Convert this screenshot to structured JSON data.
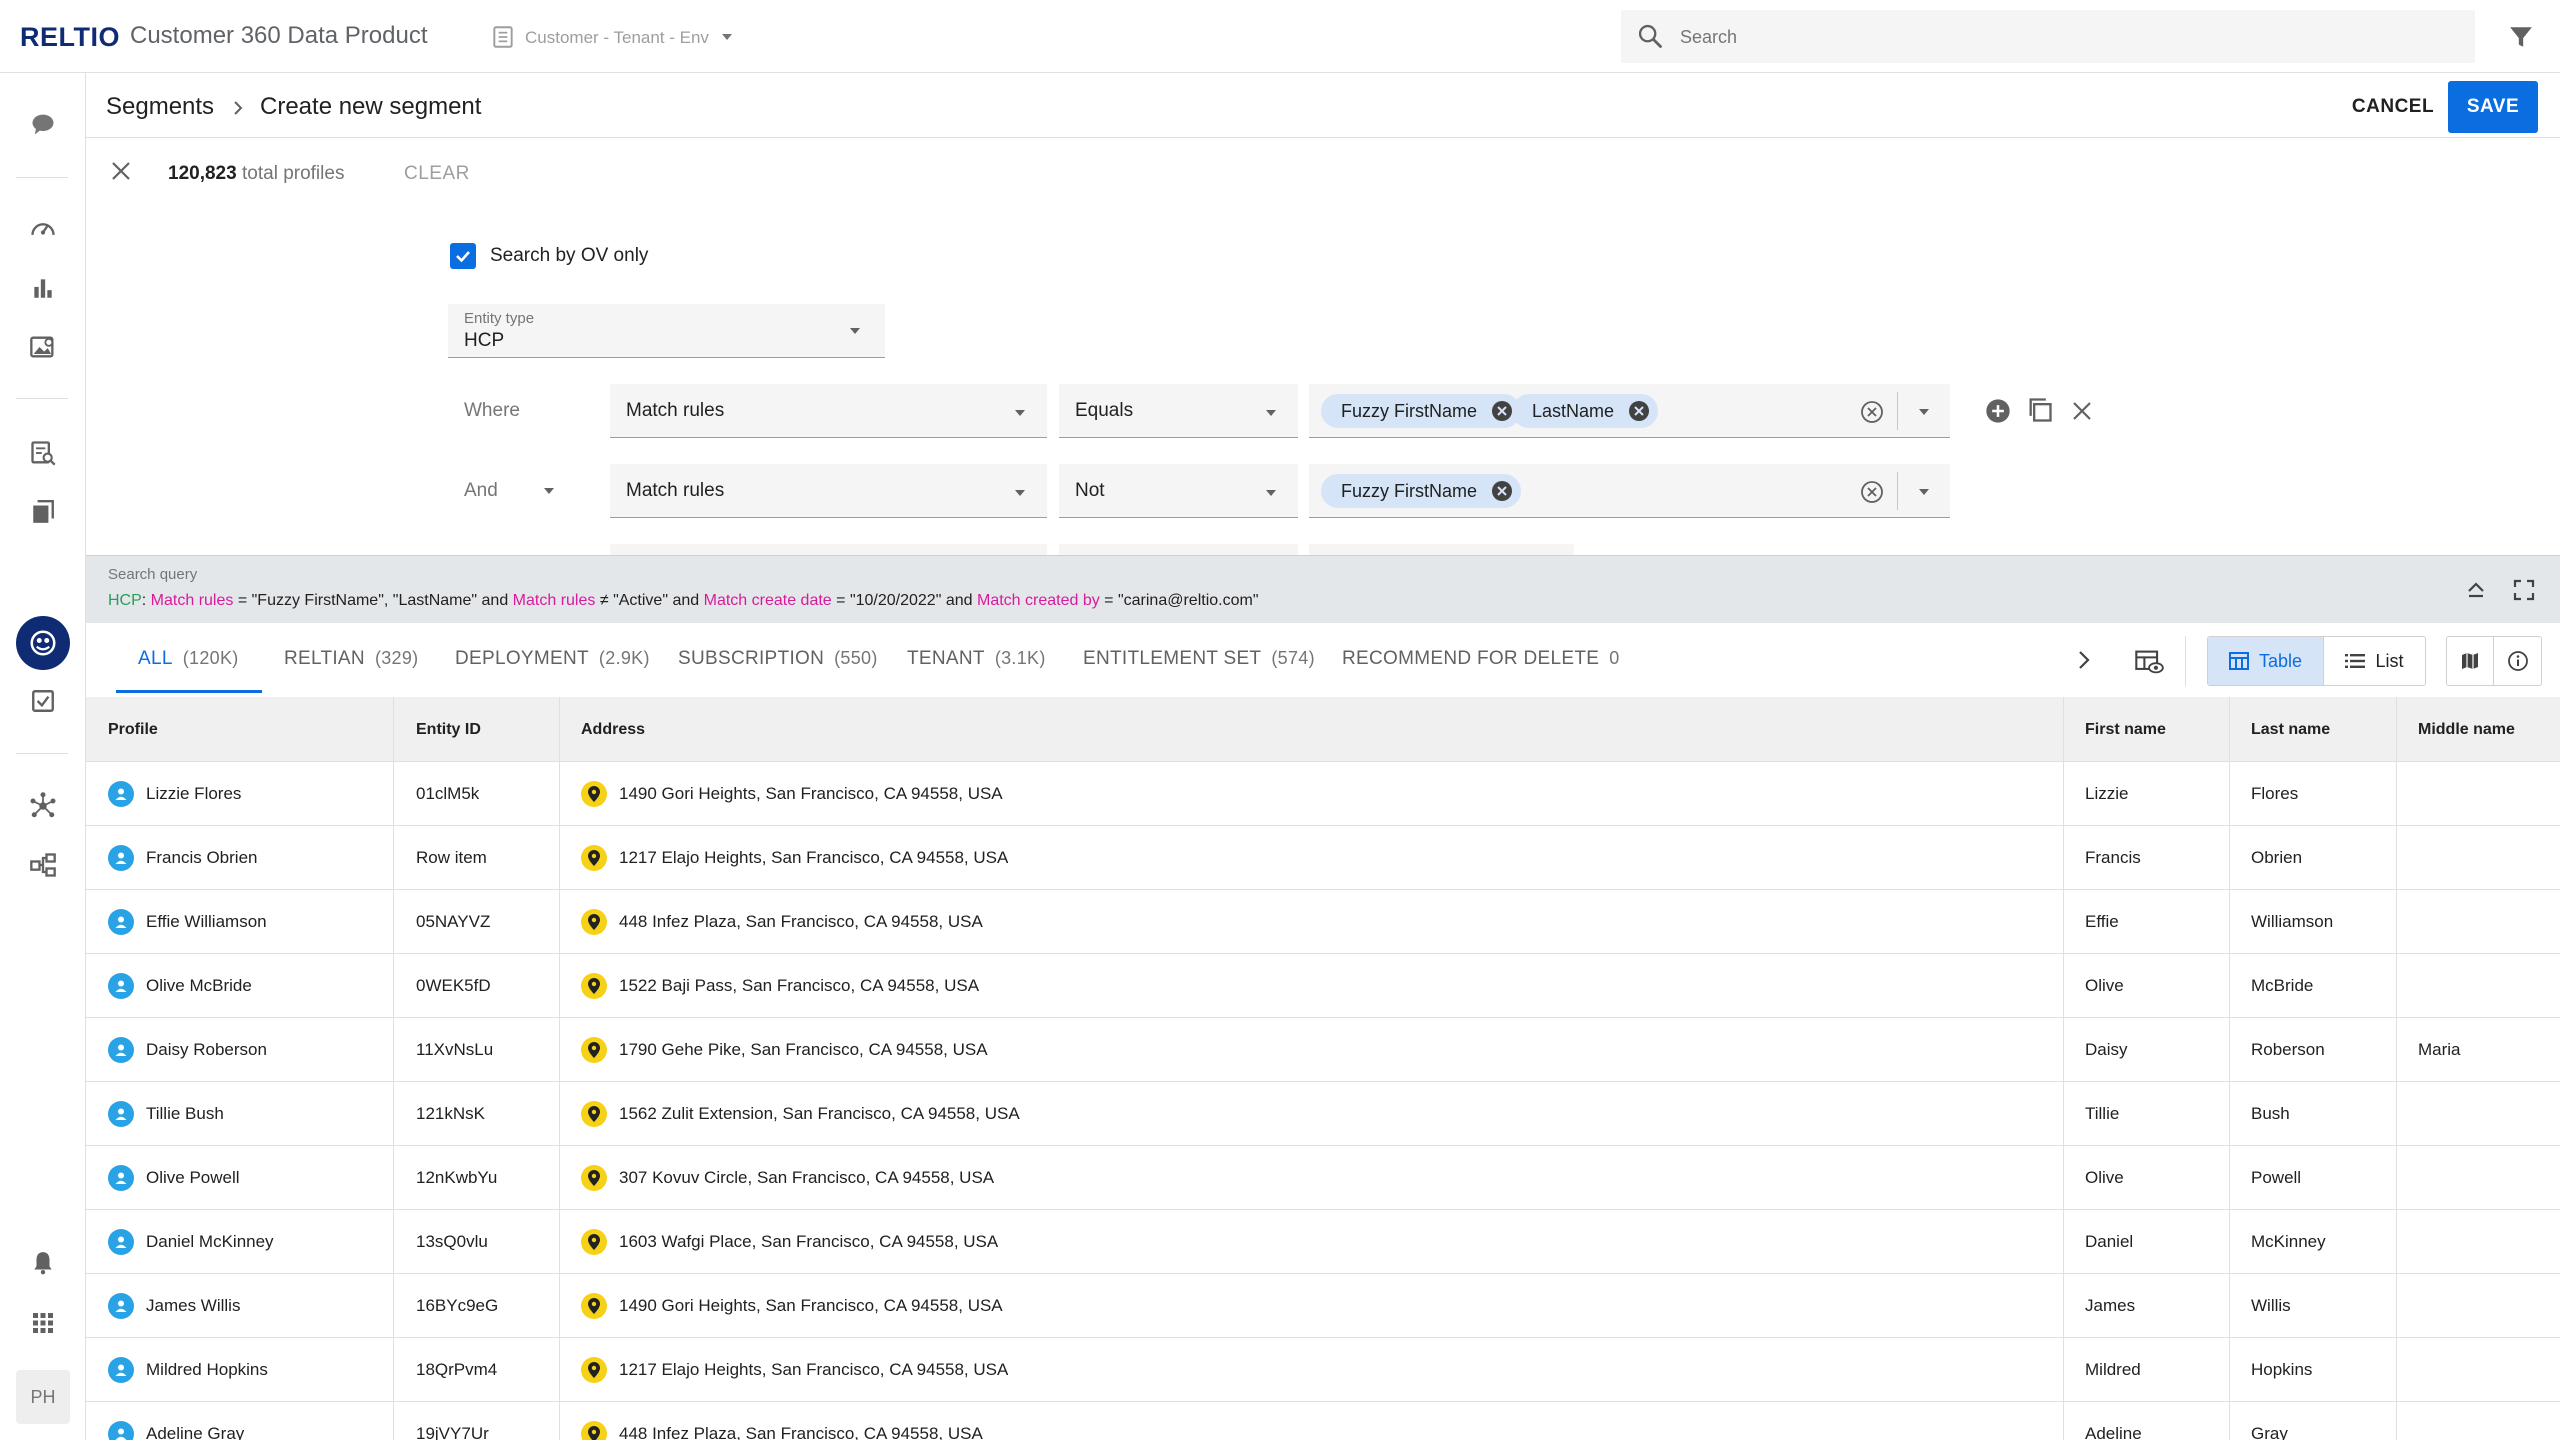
{
  "topbar": {
    "logo": "RELTIO",
    "app_title": "Customer 360 Data Product",
    "context": "Customer - Tenant - Env",
    "search_placeholder": "Search"
  },
  "leftnav": {
    "icons": [
      "chat-icon",
      "dashboard-icon",
      "bar-chart-icon",
      "image-search-icon",
      "search-list-icon",
      "library-icon",
      "segments-icon",
      "task-check-icon",
      "graph-icon",
      "hierarchy-icon",
      "bell-icon",
      "apps-grid-icon"
    ],
    "avatar_initials": "PH"
  },
  "header": {
    "breadcrumb_root": "Segments",
    "breadcrumb_current": "Create new segment",
    "cancel_label": "CANCEL",
    "save_label": "SAVE"
  },
  "summary": {
    "total_count": "120,823",
    "total_label": "total profiles",
    "clear_label": "CLEAR"
  },
  "builder": {
    "ov_only_label": "Search by OV only",
    "ov_only_checked": true,
    "entity_type_caption": "Entity type",
    "entity_type_value": "HCP",
    "conditions": [
      {
        "connector": "Where",
        "attribute": "Match rules",
        "operator": "Equals",
        "values": [
          "Fuzzy FirstName",
          "LastName"
        ]
      },
      {
        "connector": "And",
        "attribute": "Match rules",
        "operator": "Not",
        "values": [
          "Fuzzy FirstName"
        ]
      }
    ]
  },
  "search_query": {
    "title": "Search query",
    "entity": "HCP",
    "parts": [
      {
        "attr": "Match rules",
        "op": "=",
        "val": "\"Fuzzy FirstName\", \"LastName\""
      },
      {
        "conj": "and",
        "attr": "Match rules",
        "op": "≠",
        "val": "\"Active\""
      },
      {
        "conj": "and",
        "attr": "Match create date",
        "op": "=",
        "val": "\"10/20/2022\""
      },
      {
        "conj": "and",
        "attr": "Match created by",
        "op": "=",
        "val": "\"carina@reltio.com\""
      }
    ]
  },
  "tabs": [
    {
      "label": "ALL",
      "count": "(120K)",
      "active": true
    },
    {
      "label": "RELTIAN",
      "count": "(329)"
    },
    {
      "label": "DEPLOYMENT",
      "count": "(2.9K)"
    },
    {
      "label": "SUBSCRIPTION",
      "count": "(550)"
    },
    {
      "label": "TENANT",
      "count": "(3.1K)"
    },
    {
      "label": "ENTITLEMENT SET",
      "count": "(574)"
    },
    {
      "label": "RECOMMEND FOR DELETE",
      "count": "0"
    }
  ],
  "view_toggle": {
    "table_label": "Table",
    "list_label": "List",
    "selected": "Table"
  },
  "table": {
    "columns": [
      "Profile",
      "Entity ID",
      "Address",
      "First name",
      "Last name",
      "Middle name"
    ],
    "rows": [
      {
        "profile": "Lizzie Flores",
        "entity_id": "01clM5k",
        "address": "1490 Gori Heights, San Francisco, CA 94558, USA",
        "first": "Lizzie",
        "last": "Flores",
        "middle": ""
      },
      {
        "profile": "Francis Obrien",
        "entity_id": "Row item",
        "address": "1217 Elajo Heights, San Francisco, CA 94558, USA",
        "first": "Francis",
        "last": "Obrien",
        "middle": ""
      },
      {
        "profile": "Effie Williamson",
        "entity_id": "05NAYVZ",
        "address": "448 Infez Plaza, San Francisco, CA 94558, USA",
        "first": "Effie",
        "last": "Williamson",
        "middle": ""
      },
      {
        "profile": "Olive McBride",
        "entity_id": "0WEK5fD",
        "address": "1522 Baji Pass, San Francisco, CA 94558, USA",
        "first": "Olive",
        "last": "McBride",
        "middle": ""
      },
      {
        "profile": "Daisy Roberson",
        "entity_id": "11XvNsLu",
        "address": "1790 Gehe Pike, San Francisco, CA 94558, USA",
        "first": "Daisy",
        "last": "Roberson",
        "middle": "Maria"
      },
      {
        "profile": "Tillie Bush",
        "entity_id": "121kNsK",
        "address": "1562 Zulit Extension, San Francisco, CA 94558, USA",
        "first": "Tillie",
        "last": "Bush",
        "middle": ""
      },
      {
        "profile": "Olive Powell",
        "entity_id": "12nKwbYu",
        "address": "307 Kovuv Circle, San Francisco, CA 94558, USA",
        "first": "Olive",
        "last": "Powell",
        "middle": ""
      },
      {
        "profile": "Daniel McKinney",
        "entity_id": "13sQ0vlu",
        "address": "1603 Wafgi Place, San Francisco, CA 94558, USA",
        "first": "Daniel",
        "last": "McKinney",
        "middle": ""
      },
      {
        "profile": "James Willis",
        "entity_id": "16BYc9eG",
        "address": "1490 Gori Heights, San Francisco, CA 94558, USA",
        "first": "James",
        "last": "Willis",
        "middle": ""
      },
      {
        "profile": "Mildred Hopkins",
        "entity_id": "18QrPvm4",
        "address": "1217 Elajo Heights, San Francisco, CA 94558, USA",
        "first": "Mildred",
        "last": "Hopkins",
        "middle": ""
      },
      {
        "profile": "Adeline Gray",
        "entity_id": "19jVY7Ur",
        "address": "448 Infez Plaza, San Francisco, CA 94558, USA",
        "first": "Adeline",
        "last": "Gray",
        "middle": ""
      }
    ]
  },
  "colors": {
    "brand": "#0f2b73",
    "accent": "#0a6ee0",
    "chip": "#d6e4f7",
    "pin": "#f7d117",
    "profile_icon": "#29a3e6",
    "query_entity": "#2a9d5b",
    "query_attr": "#d81b9c"
  }
}
